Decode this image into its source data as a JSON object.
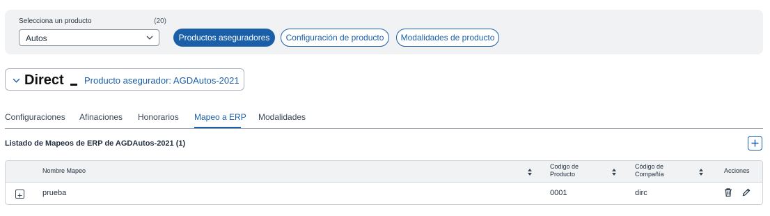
{
  "filter": {
    "label": "Selecciona un producto",
    "count": "(20)",
    "selected": "Autos"
  },
  "nav_pills": {
    "productos": "Productos aseguradores",
    "configuracion": "Configuración de producto",
    "modalidades": "Modalidades de producto"
  },
  "product_card": {
    "brand": "Direct",
    "title": "Producto asegurador: AGDAutos-2021"
  },
  "tabs": [
    "Configuraciones",
    "Afinaciones",
    "Honorarios",
    "Mapeo a ERP",
    "Modalidades"
  ],
  "active_tab": "Mapeo a ERP",
  "list": {
    "title": "Listado de Mapeos de ERP de AGDAutos-2021 (1)"
  },
  "table": {
    "columns": {
      "nombre": "Nombre Mapeo",
      "codigo_producto_1": "Codigo de",
      "codigo_producto_2": "Producto",
      "codigo_compania_1": "Código de",
      "codigo_compania_2": "Compañía",
      "acciones": "Acciones"
    },
    "rows": [
      {
        "nombre": "prueba",
        "codigo_producto": "0001",
        "codigo_compania": "dirc"
      }
    ]
  },
  "colors": {
    "accent": "#1b5fa8",
    "panel": "#f1f2f4",
    "text": "#1f2d3d"
  },
  "icons": [
    "chevron-down-icon",
    "plus-icon",
    "sort-icon",
    "expand-icon",
    "trash-icon",
    "pencil-icon"
  ]
}
